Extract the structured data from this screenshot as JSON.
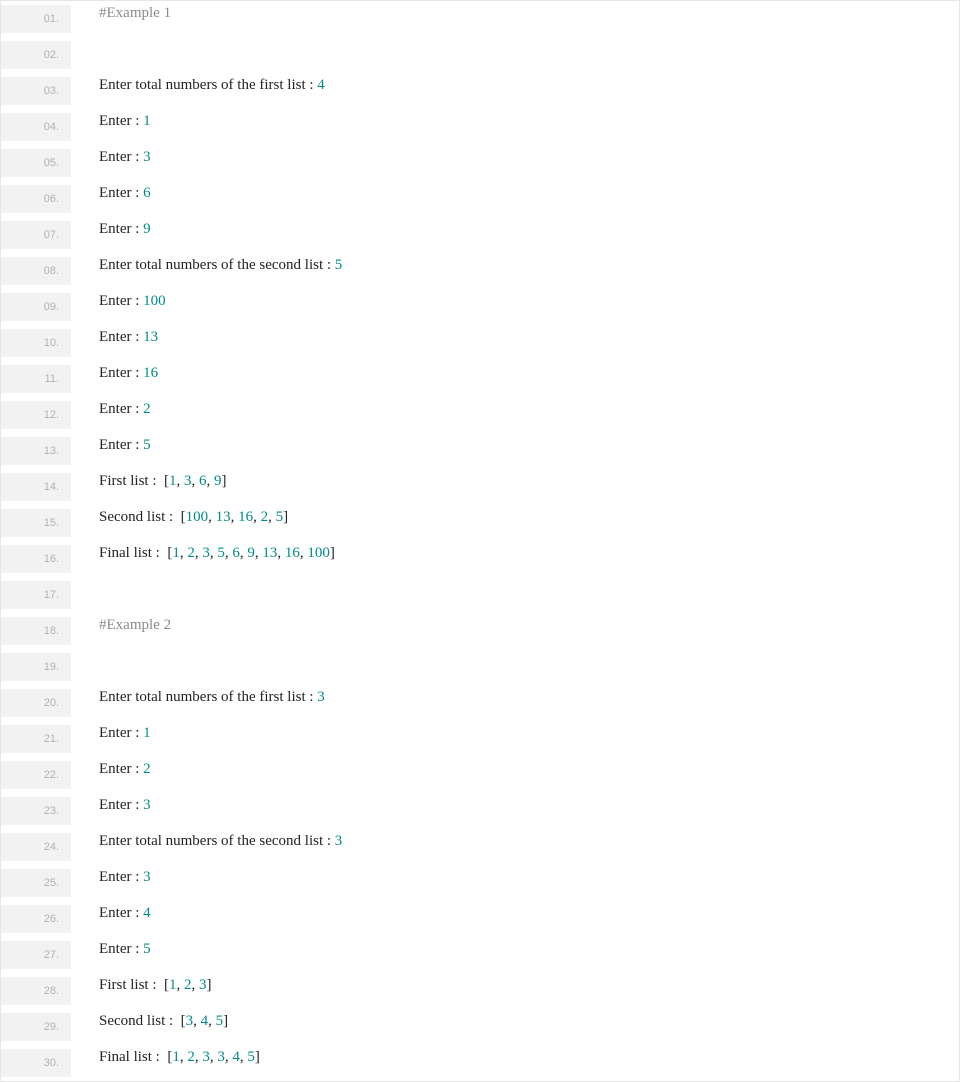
{
  "code": {
    "lines": [
      {
        "n": "01.",
        "t": [
          [
            "comment",
            "#Example 1"
          ]
        ]
      },
      {
        "n": "02.",
        "t": []
      },
      {
        "n": "03.",
        "t": [
          [
            "plain",
            "Enter total numbers of the first list : "
          ],
          [
            "number",
            "4"
          ]
        ]
      },
      {
        "n": "04.",
        "t": [
          [
            "plain",
            "Enter : "
          ],
          [
            "number",
            "1"
          ]
        ]
      },
      {
        "n": "05.",
        "t": [
          [
            "plain",
            "Enter : "
          ],
          [
            "number",
            "3"
          ]
        ]
      },
      {
        "n": "06.",
        "t": [
          [
            "plain",
            "Enter : "
          ],
          [
            "number",
            "6"
          ]
        ]
      },
      {
        "n": "07.",
        "t": [
          [
            "plain",
            "Enter : "
          ],
          [
            "number",
            "9"
          ]
        ]
      },
      {
        "n": "08.",
        "t": [
          [
            "plain",
            "Enter total numbers of the second list : "
          ],
          [
            "number",
            "5"
          ]
        ]
      },
      {
        "n": "09.",
        "t": [
          [
            "plain",
            "Enter : "
          ],
          [
            "number",
            "100"
          ]
        ]
      },
      {
        "n": "10.",
        "t": [
          [
            "plain",
            "Enter : "
          ],
          [
            "number",
            "13"
          ]
        ]
      },
      {
        "n": "11.",
        "t": [
          [
            "plain",
            "Enter : "
          ],
          [
            "number",
            "16"
          ]
        ]
      },
      {
        "n": "12.",
        "t": [
          [
            "plain",
            "Enter : "
          ],
          [
            "number",
            "2"
          ]
        ]
      },
      {
        "n": "13.",
        "t": [
          [
            "plain",
            "Enter : "
          ],
          [
            "number",
            "5"
          ]
        ]
      },
      {
        "n": "14.",
        "t": [
          [
            "plain",
            "First list :  ["
          ],
          [
            "number",
            "1"
          ],
          [
            "plain",
            ", "
          ],
          [
            "number",
            "3"
          ],
          [
            "plain",
            ", "
          ],
          [
            "number",
            "6"
          ],
          [
            "plain",
            ", "
          ],
          [
            "number",
            "9"
          ],
          [
            "plain",
            "]"
          ]
        ]
      },
      {
        "n": "15.",
        "t": [
          [
            "plain",
            "Second list :  ["
          ],
          [
            "number",
            "100"
          ],
          [
            "plain",
            ", "
          ],
          [
            "number",
            "13"
          ],
          [
            "plain",
            ", "
          ],
          [
            "number",
            "16"
          ],
          [
            "plain",
            ", "
          ],
          [
            "number",
            "2"
          ],
          [
            "plain",
            ", "
          ],
          [
            "number",
            "5"
          ],
          [
            "plain",
            "]"
          ]
        ]
      },
      {
        "n": "16.",
        "t": [
          [
            "plain",
            "Final list :  ["
          ],
          [
            "number",
            "1"
          ],
          [
            "plain",
            ", "
          ],
          [
            "number",
            "2"
          ],
          [
            "plain",
            ", "
          ],
          [
            "number",
            "3"
          ],
          [
            "plain",
            ", "
          ],
          [
            "number",
            "5"
          ],
          [
            "plain",
            ", "
          ],
          [
            "number",
            "6"
          ],
          [
            "plain",
            ", "
          ],
          [
            "number",
            "9"
          ],
          [
            "plain",
            ", "
          ],
          [
            "number",
            "13"
          ],
          [
            "plain",
            ", "
          ],
          [
            "number",
            "16"
          ],
          [
            "plain",
            ", "
          ],
          [
            "number",
            "100"
          ],
          [
            "plain",
            "]"
          ]
        ]
      },
      {
        "n": "17.",
        "t": []
      },
      {
        "n": "18.",
        "t": [
          [
            "comment",
            "#Example 2"
          ]
        ]
      },
      {
        "n": "19.",
        "t": []
      },
      {
        "n": "20.",
        "t": [
          [
            "plain",
            "Enter total numbers of the first list : "
          ],
          [
            "number",
            "3"
          ]
        ]
      },
      {
        "n": "21.",
        "t": [
          [
            "plain",
            "Enter : "
          ],
          [
            "number",
            "1"
          ]
        ]
      },
      {
        "n": "22.",
        "t": [
          [
            "plain",
            "Enter : "
          ],
          [
            "number",
            "2"
          ]
        ]
      },
      {
        "n": "23.",
        "t": [
          [
            "plain",
            "Enter : "
          ],
          [
            "number",
            "3"
          ]
        ]
      },
      {
        "n": "24.",
        "t": [
          [
            "plain",
            "Enter total numbers of the second list : "
          ],
          [
            "number",
            "3"
          ]
        ]
      },
      {
        "n": "25.",
        "t": [
          [
            "plain",
            "Enter : "
          ],
          [
            "number",
            "3"
          ]
        ]
      },
      {
        "n": "26.",
        "t": [
          [
            "plain",
            "Enter : "
          ],
          [
            "number",
            "4"
          ]
        ]
      },
      {
        "n": "27.",
        "t": [
          [
            "plain",
            "Enter : "
          ],
          [
            "number",
            "5"
          ]
        ]
      },
      {
        "n": "28.",
        "t": [
          [
            "plain",
            "First list :  ["
          ],
          [
            "number",
            "1"
          ],
          [
            "plain",
            ", "
          ],
          [
            "number",
            "2"
          ],
          [
            "plain",
            ", "
          ],
          [
            "number",
            "3"
          ],
          [
            "plain",
            "]"
          ]
        ]
      },
      {
        "n": "29.",
        "t": [
          [
            "plain",
            "Second list :  ["
          ],
          [
            "number",
            "3"
          ],
          [
            "plain",
            ", "
          ],
          [
            "number",
            "4"
          ],
          [
            "plain",
            ", "
          ],
          [
            "number",
            "5"
          ],
          [
            "plain",
            "]"
          ]
        ]
      },
      {
        "n": "30.",
        "t": [
          [
            "plain",
            "Final list :  ["
          ],
          [
            "number",
            "1"
          ],
          [
            "plain",
            ", "
          ],
          [
            "number",
            "2"
          ],
          [
            "plain",
            ", "
          ],
          [
            "number",
            "3"
          ],
          [
            "plain",
            ", "
          ],
          [
            "number",
            "3"
          ],
          [
            "plain",
            ", "
          ],
          [
            "number",
            "4"
          ],
          [
            "plain",
            ", "
          ],
          [
            "number",
            "5"
          ],
          [
            "plain",
            "]"
          ]
        ]
      }
    ]
  }
}
